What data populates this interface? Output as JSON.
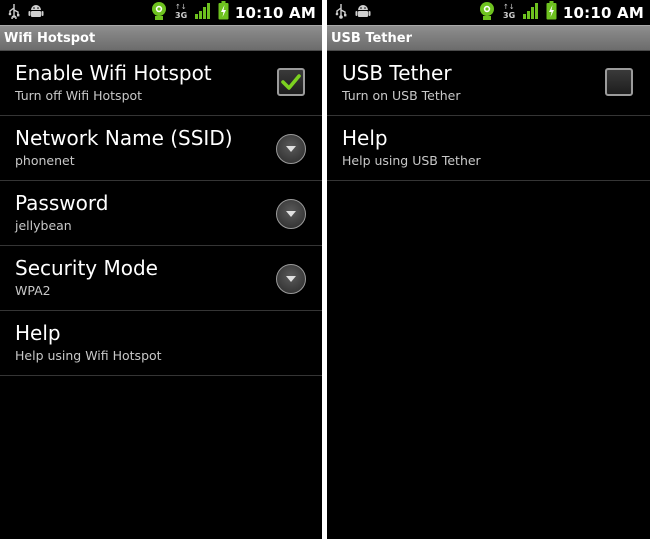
{
  "left": {
    "status": {
      "time": "10:10 AM",
      "network": "3G"
    },
    "title": "Wifi Hotspot",
    "items": [
      {
        "title": "Enable Wifi Hotspot",
        "summary": "Turn off Wifi Hotspot",
        "widget": "checkbox",
        "checked": true
      },
      {
        "title": "Network Name (SSID)",
        "summary": "phonenet",
        "widget": "chevron-down"
      },
      {
        "title": "Password",
        "summary": "jellybean",
        "widget": "chevron-down"
      },
      {
        "title": "Security Mode",
        "summary": "WPA2",
        "widget": "chevron-down"
      },
      {
        "title": "Help",
        "summary": "Help using Wifi Hotspot"
      }
    ]
  },
  "right": {
    "status": {
      "time": "10:10 AM",
      "network": "3G"
    },
    "title": "USB Tether",
    "items": [
      {
        "title": "USB Tether",
        "summary": "Turn on USB Tether",
        "widget": "checkbox",
        "checked": false
      },
      {
        "title": "Help",
        "summary": "Help using USB Tether"
      }
    ]
  },
  "colors": {
    "background": "#000000",
    "title_bar": "#7d7d7d",
    "check_green": "#7cd120",
    "divider": "#353535",
    "summary_text": "#c8c8c8"
  }
}
